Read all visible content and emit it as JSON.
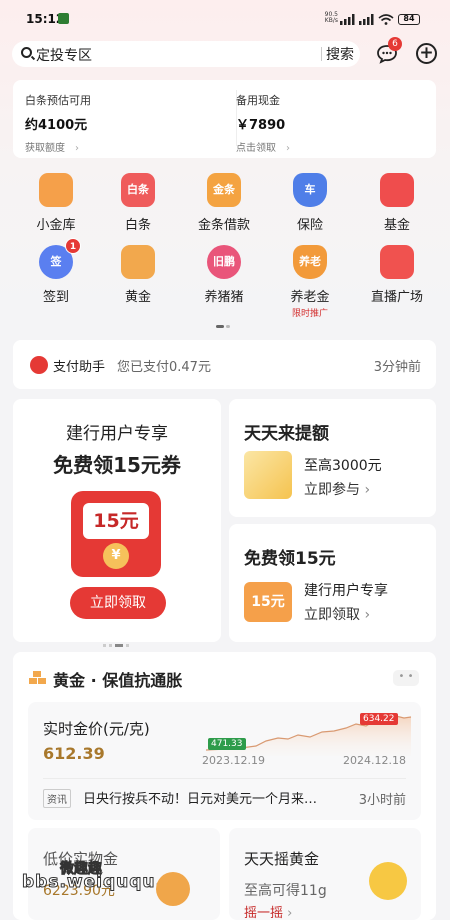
{
  "status_bar": {
    "time": "15:12",
    "net_speed": "90.5",
    "net_unit": "KB/s",
    "battery": "84"
  },
  "search": {
    "placeholder": "定投专区",
    "button": "搜索",
    "msg_badge": "6"
  },
  "credit": {
    "left_label": "白条预估可用",
    "left_value": "约4100元",
    "left_link": "获取额度",
    "right_label": "备用现金",
    "right_value": "￥7890",
    "right_link": "点击领取"
  },
  "grid": [
    {
      "label": "小金库",
      "icon": "piggy-bag-icon",
      "color": "#f5a04a"
    },
    {
      "label": "白条",
      "icon": "baitiao-icon",
      "color": "#ef5b5b",
      "glyph": "白条"
    },
    {
      "label": "金条借款",
      "icon": "jintiao-icon",
      "color": "#f4a341",
      "glyph": "金条"
    },
    {
      "label": "保险",
      "icon": "shield-icon",
      "color": "#4f7ee8",
      "glyph": "车"
    },
    {
      "label": "基金",
      "icon": "chart-icon",
      "color": "#ef4d4d"
    },
    {
      "label": "签到",
      "icon": "checkin-icon",
      "color": "#5a7ff0",
      "glyph": "签",
      "badge": "1"
    },
    {
      "label": "黄金",
      "icon": "gold-bars-icon",
      "color": "#f2a84d"
    },
    {
      "label": "养猪猪",
      "icon": "pig-icon",
      "color": "#e9557a",
      "glyph": "旧鹏"
    },
    {
      "label": "养老金",
      "icon": "pension-icon",
      "color": "#f29a3a",
      "glyph": "养老",
      "sub": "限时推广"
    },
    {
      "label": "直播广场",
      "icon": "live-video-icon",
      "color": "#f0524f"
    }
  ],
  "pay": {
    "title": "支付助手",
    "text": "您已支付0.47元",
    "time": "3分钟前"
  },
  "promo_big": {
    "line1": "建行用户专享",
    "line2": "免费领15元券",
    "coupon": "15元",
    "yuan": "¥",
    "button": "立即领取"
  },
  "promo_a": {
    "title": "天天来提额",
    "line1": "至高3000元",
    "line2": "立即参与"
  },
  "promo_b": {
    "title": "免费领15元",
    "badge": "15元",
    "line1": "建行用户专享",
    "line2": "立即领取"
  },
  "gold": {
    "title": "黄金 · 保值抗通胀",
    "more": "• •",
    "price_label": "实时金价(元/克)",
    "price_value": "612.39",
    "low": "471.33",
    "high": "634.22",
    "start_date": "2023.12.19",
    "end_date": "2024.12.18",
    "news_tag": "资讯",
    "news": "日央行按兵不动！日元对美元一个月来…",
    "news_time": "3小时前",
    "sub1_title": "低价实物金",
    "sub1_value": "6223.90元",
    "sub2_title": "天天摇黄金",
    "sub2_value": "至高可得11g",
    "sub2_link": "摇一摇"
  },
  "watermark": {
    "line1": "微趣趣",
    "line2": "bbs.weiququ.cn"
  }
}
